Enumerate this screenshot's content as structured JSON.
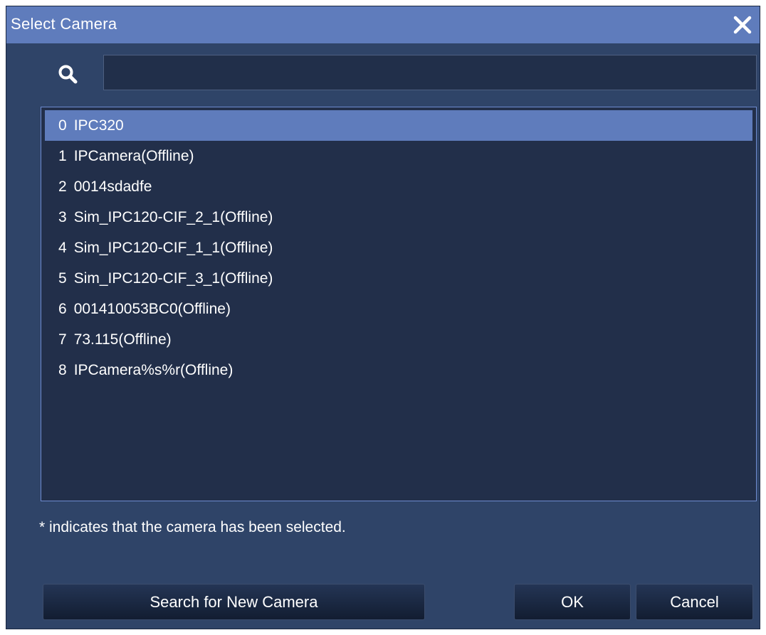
{
  "dialog": {
    "title": "Select Camera",
    "close_icon": "close-icon"
  },
  "search": {
    "icon": "search-icon",
    "value": "",
    "placeholder": ""
  },
  "cameras": [
    {
      "index": "0",
      "name": "IPC320",
      "selected": true
    },
    {
      "index": "1",
      "name": "IPCamera(Offline)",
      "selected": false
    },
    {
      "index": "2",
      "name": "0014sdadfe",
      "selected": false
    },
    {
      "index": "3",
      "name": "Sim_IPC120-CIF_2_1(Offline)",
      "selected": false
    },
    {
      "index": "4",
      "name": "Sim_IPC120-CIF_1_1(Offline)",
      "selected": false
    },
    {
      "index": "5",
      "name": "Sim_IPC120-CIF_3_1(Offline)",
      "selected": false
    },
    {
      "index": "6",
      "name": "001410053BC0(Offline)",
      "selected": false
    },
    {
      "index": "7",
      "name": "73.115(Offline)",
      "selected": false
    },
    {
      "index": "8",
      "name": "IPCamera%s%r(Offline)",
      "selected": false
    }
  ],
  "note": "* indicates that the camera has been selected.",
  "buttons": {
    "search_new": "Search for New Camera",
    "ok": "OK",
    "cancel": "Cancel"
  },
  "colors": {
    "titlebar": "#5f7cbc",
    "dialog_bg": "#2f4468",
    "list_bg": "#222f4a",
    "selected_row": "#5f7cbc",
    "list_border": "#6e8bd0"
  }
}
